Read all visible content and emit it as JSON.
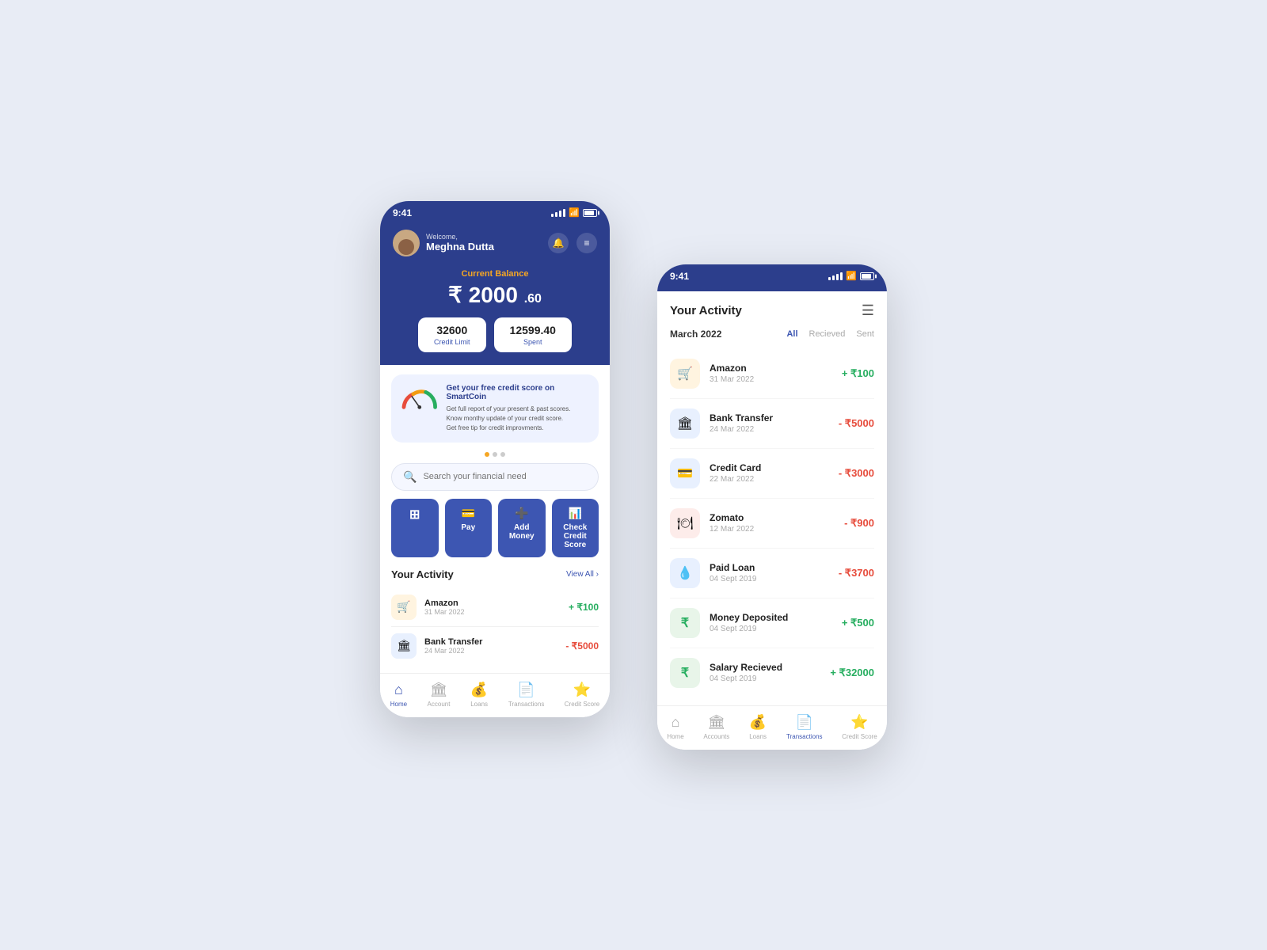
{
  "background": "#e8ecf5",
  "phone1": {
    "statusBar": {
      "time": "9:41",
      "batteryLabel": "battery"
    },
    "header": {
      "welcomeText": "Welcome,",
      "userName": "Meghna Dutta"
    },
    "balance": {
      "label": "Current Balance",
      "currencySymbol": "₹",
      "whole": "2000",
      "decimal": ".60"
    },
    "stats": [
      {
        "value": "32600",
        "label": "Credit Limit"
      },
      {
        "value": "12599",
        "decimal": ".40",
        "label": "Spent"
      }
    ],
    "promo": {
      "title": "Get your free credit score on SmartCoin",
      "lines": [
        "Get full report of your present & past scores.",
        "Know monthy update of your credit score.",
        "Get free tip for credit improvments."
      ]
    },
    "search": {
      "placeholder": "Search your financial need"
    },
    "actions": [
      {
        "id": "scan",
        "icon": "⊞",
        "label": ""
      },
      {
        "id": "pay",
        "icon": "",
        "label": "Pay"
      },
      {
        "id": "add-money",
        "icon": "",
        "label": "Add Money"
      },
      {
        "id": "check-credit",
        "icon": "",
        "label": "Check Credit Score"
      }
    ],
    "activity": {
      "title": "Your Activity",
      "viewAll": "View All ›",
      "transactions": [
        {
          "name": "Amazon",
          "date": "31 Mar 2022",
          "amount": "+ ₹100",
          "positive": true,
          "icon": "🛒",
          "bg": "#fff4e0"
        },
        {
          "name": "Bank Transfer",
          "date": "24 Mar 2022",
          "amount": "- ₹5000",
          "positive": false,
          "icon": "🏛",
          "bg": "#e8f0fe"
        }
      ]
    },
    "bottomNav": [
      {
        "icon": "⌂",
        "label": "Home",
        "active": true
      },
      {
        "icon": "🏛",
        "label": "Account",
        "active": false
      },
      {
        "icon": "💰",
        "label": "Loans",
        "active": false
      },
      {
        "icon": "📄",
        "label": "Transactions",
        "active": false
      },
      {
        "icon": "⭐",
        "label": "Credit Score",
        "active": false
      }
    ]
  },
  "phone2": {
    "statusBar": {
      "time": "9:41"
    },
    "activityPage": {
      "title": "Your Activity",
      "month": "March 2022",
      "filterTabs": [
        {
          "label": "All",
          "active": true
        },
        {
          "label": "Recieved",
          "active": false
        },
        {
          "label": "Sent",
          "active": false
        }
      ],
      "transactions": [
        {
          "name": "Amazon",
          "date": "31 Mar 2022",
          "amount": "+ ₹100",
          "positive": true,
          "icon": "🛒",
          "bg": "#fff4e0"
        },
        {
          "name": "Bank Transfer",
          "date": "24 Mar 2022",
          "amount": "- ₹5000",
          "positive": false,
          "icon": "🏛",
          "bg": "#e8f0fe"
        },
        {
          "name": "Credit Card",
          "date": "22 Mar 2022",
          "amount": "- ₹3000",
          "positive": false,
          "icon": "💳",
          "bg": "#e8f0fe"
        },
        {
          "name": "Zomato",
          "date": "12 Mar 2022",
          "amount": "- ₹900",
          "positive": false,
          "icon": "🍽",
          "bg": "#fdecea"
        },
        {
          "name": "Paid Loan",
          "date": "04 Sept 2019",
          "amount": "- ₹3700",
          "positive": false,
          "icon": "💧",
          "bg": "#e8f0fe"
        },
        {
          "name": "Money Deposited",
          "date": "04 Sept 2019",
          "amount": "+ ₹500",
          "positive": true,
          "icon": "₹",
          "bg": "#e8f5e9"
        },
        {
          "name": "Salary Recieved",
          "date": "04 Sept 2019",
          "amount": "+ ₹32000",
          "positive": true,
          "icon": "₹",
          "bg": "#e8f5e9"
        }
      ]
    },
    "bottomNav": [
      {
        "icon": "⌂",
        "label": "Home",
        "active": false
      },
      {
        "icon": "🏛",
        "label": "Accounts",
        "active": false
      },
      {
        "icon": "💰",
        "label": "Loans",
        "active": false
      },
      {
        "icon": "📄",
        "label": "Transactions",
        "active": true
      },
      {
        "icon": "⭐",
        "label": "Credit Score",
        "active": false
      }
    ]
  }
}
